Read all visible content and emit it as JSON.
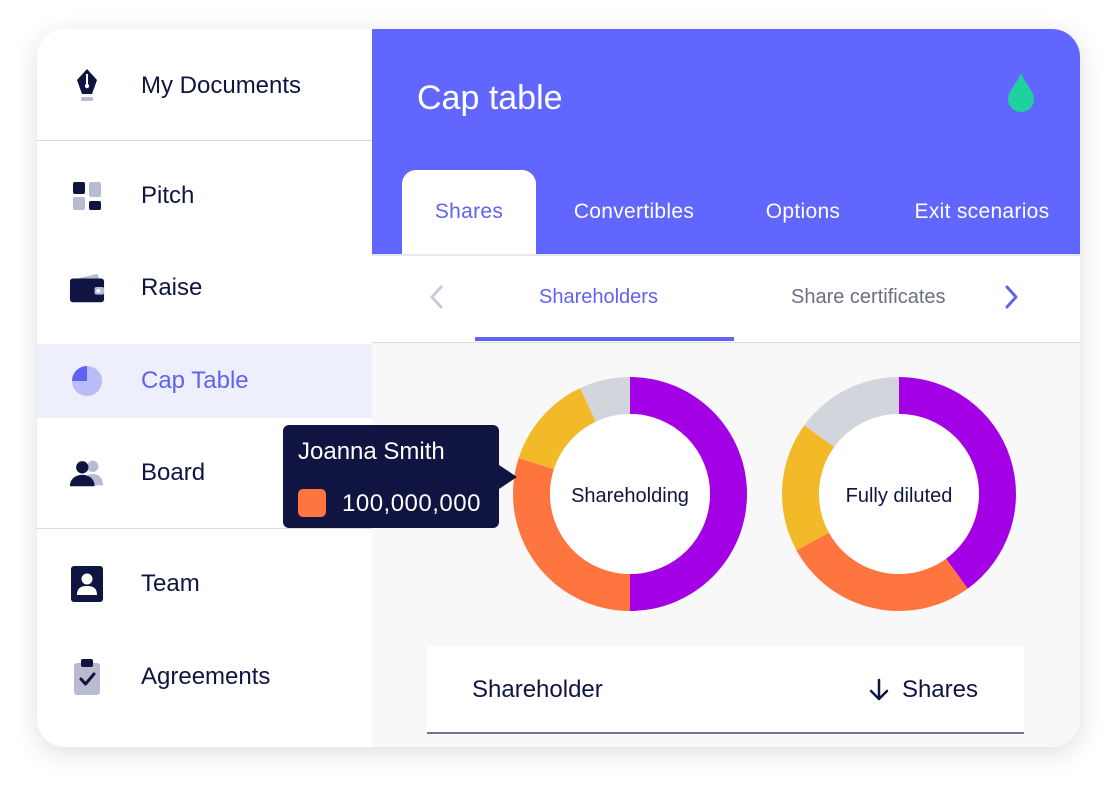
{
  "sidebar": {
    "items": [
      {
        "label": "My Documents",
        "icon": "fountain-pen-icon"
      },
      {
        "label": "Pitch",
        "icon": "dashboard-icon"
      },
      {
        "label": "Raise",
        "icon": "wallet-icon"
      },
      {
        "label": "Cap Table",
        "icon": "pie-chart-icon"
      },
      {
        "label": "Board",
        "icon": "people-icon"
      },
      {
        "label": "Team",
        "icon": "id-badge-icon"
      },
      {
        "label": "Agreements",
        "icon": "clipboard-check-icon"
      }
    ],
    "active_index": 3
  },
  "header": {
    "title": "Cap table",
    "icon": "drop-icon",
    "tabs": [
      "Shares",
      "Convertibles",
      "Options",
      "Exit scenarios"
    ],
    "active_tab": 0
  },
  "subtabs": {
    "items": [
      "Shareholders",
      "Share certificates"
    ],
    "active_index": 0
  },
  "tooltip": {
    "name": "Joanna Smith",
    "value": "100,000,000",
    "color": "#ff7540"
  },
  "chart_data": [
    {
      "type": "pie",
      "title": "Shareholding",
      "slices": [
        {
          "value": 50,
          "color": "#a300e6"
        },
        {
          "value": 30,
          "color": "#ff7540"
        },
        {
          "value": 13,
          "color": "#f2b929"
        },
        {
          "value": 7,
          "color": "#d3d5dc"
        }
      ]
    },
    {
      "type": "pie",
      "title": "Fully diluted",
      "slices": [
        {
          "value": 40,
          "color": "#a300e6"
        },
        {
          "value": 27,
          "color": "#ff7540"
        },
        {
          "value": 18,
          "color": "#f2b929"
        },
        {
          "value": 15,
          "color": "#d3d5dc"
        }
      ]
    }
  ],
  "table": {
    "columns": [
      "Shareholder",
      "Shares"
    ],
    "sort_icon": "arrow-down-icon"
  },
  "colors": {
    "accent": "#6066ff",
    "active_text": "#5f63f0",
    "navy": "#0f1540",
    "drop": "#1dd29c"
  }
}
